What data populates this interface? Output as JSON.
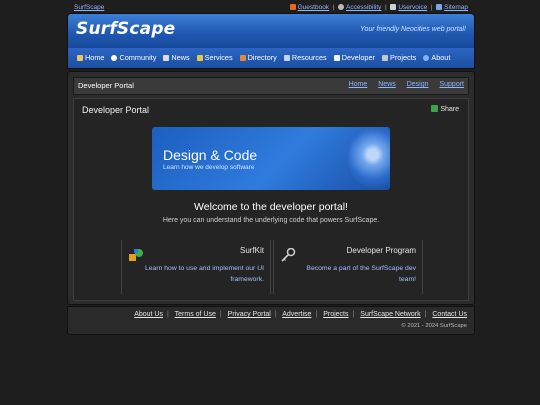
{
  "top": {
    "site_link": "SurfScape",
    "links": [
      {
        "label": "Guestbook",
        "icon": "flag-icon",
        "color": "#e06c1a"
      },
      {
        "label": "Accessibility",
        "icon": "globe-icon",
        "color": "#bbbbbb"
      },
      {
        "label": "Uservoice",
        "icon": "pencil-icon",
        "color": "#d0d0d0"
      },
      {
        "label": "Sitemap",
        "icon": "sitemap-icon",
        "color": "#7aa7e6"
      }
    ]
  },
  "banner": {
    "logo": "SurfScape",
    "tagline": "Your friendly Neocities web portal!"
  },
  "nav": [
    {
      "label": "Home",
      "icon": "home-icon",
      "color": "#e9c46a"
    },
    {
      "label": "Community",
      "icon": "chat-icon",
      "color": "#ffffff"
    },
    {
      "label": "News",
      "icon": "newspaper-icon",
      "color": "#dddddd"
    },
    {
      "label": "Services",
      "icon": "services-icon",
      "color": "#e8c547"
    },
    {
      "label": "Directory",
      "icon": "directory-icon",
      "color": "#e08b3a"
    },
    {
      "label": "Resources",
      "icon": "resources-icon",
      "color": "#c6d3ff"
    },
    {
      "label": "Developer",
      "icon": "developer-icon",
      "color": "#f0f0f0"
    },
    {
      "label": "Projects",
      "icon": "projects-icon",
      "color": "#c8c8c8"
    },
    {
      "label": "About",
      "icon": "about-icon",
      "color": "#7ab8ff"
    }
  ],
  "crumb": {
    "title": "Developer Portal",
    "sublinks": [
      "Home",
      "News",
      "Design",
      "Support"
    ]
  },
  "panel": {
    "title": "Developer Portal",
    "share": "Share",
    "hero_title": "Design & Code",
    "hero_sub": "Learn how we develop software",
    "welcome": "Welcome to the developer portal!",
    "welcome_sub": "Here you can understand the underlying code that powers SurfScape."
  },
  "cards": [
    {
      "title": "SurfKit",
      "desc": "Learn how to use and implement our UI framework.",
      "icon": "surfkit-icon"
    },
    {
      "title": "Developer Program",
      "desc": "Become a part of the SurfScape dev team!",
      "icon": "key-icon"
    }
  ],
  "footer": {
    "links": [
      "About Us",
      "Terms of Use",
      "Privacy Portal",
      "Advertise",
      "Projects",
      "SurfScape Network",
      "Contact Us"
    ],
    "copyright": "© 2021 - 2024 SurfScape"
  }
}
